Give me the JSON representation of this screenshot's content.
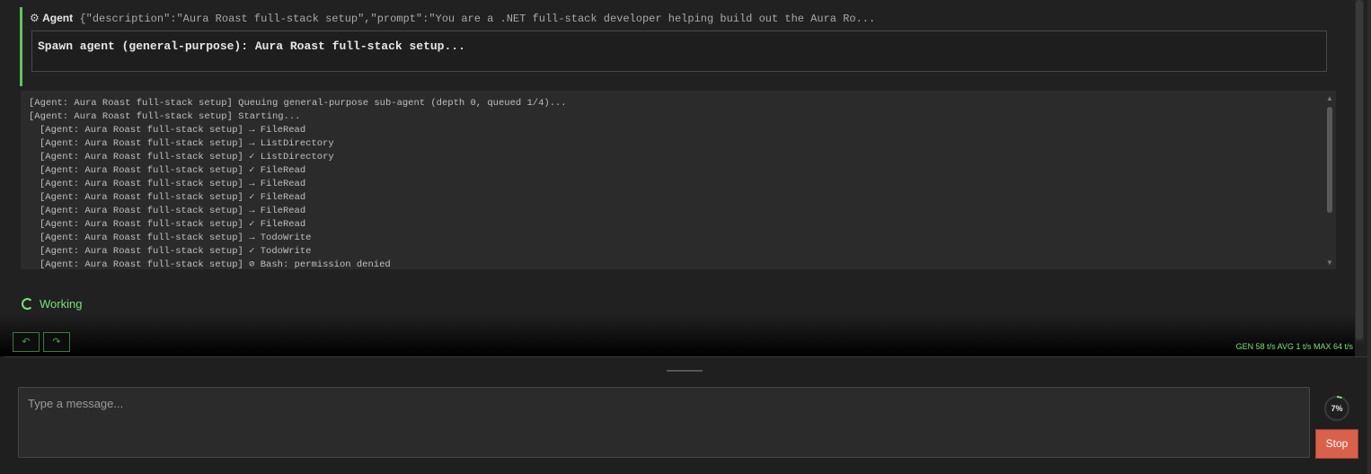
{
  "agent": {
    "gear_icon": "⚙",
    "label": "Agent",
    "args": "{\"description\":\"Aura Roast full-stack setup\",\"prompt\":\"You are a .NET full-stack developer helping build out the Aura Ro...",
    "spawn_text": "Spawn agent (general-purpose): Aura Roast full-stack setup..."
  },
  "log": {
    "lines": [
      "[Agent: Aura Roast full-stack setup] Queuing general-purpose sub-agent (depth 0, queued 1/4)...",
      "[Agent: Aura Roast full-stack setup] Starting...",
      "[Agent: Aura Roast full-stack setup] → FileRead",
      "[Agent: Aura Roast full-stack setup] → ListDirectory",
      "[Agent: Aura Roast full-stack setup] ✓ ListDirectory",
      "[Agent: Aura Roast full-stack setup] ✓ FileRead",
      "[Agent: Aura Roast full-stack setup] → FileRead",
      "[Agent: Aura Roast full-stack setup] ✓ FileRead",
      "[Agent: Aura Roast full-stack setup] → FileRead",
      "[Agent: Aura Roast full-stack setup] ✓ FileRead",
      "[Agent: Aura Roast full-stack setup] → TodoWrite",
      "[Agent: Aura Roast full-stack setup] ✓ TodoWrite",
      "[Agent: Aura Roast full-stack setup] ⊘ Bash: permission denied"
    ]
  },
  "status": {
    "working_label": "Working"
  },
  "nav": {
    "undo_icon": "↶",
    "redo_icon": "↷"
  },
  "stats": {
    "text": "GEN 58 t/s AVG 1 t/s MAX 64 t/s"
  },
  "input": {
    "placeholder": "Type a message...",
    "value": ""
  },
  "context": {
    "percent_label": "7%",
    "fraction": 0.07
  },
  "actions": {
    "stop_label": "Stop"
  },
  "colors": {
    "accent": "#7be07b",
    "stop": "#d9604a",
    "agent_border": "#5ec45e"
  }
}
